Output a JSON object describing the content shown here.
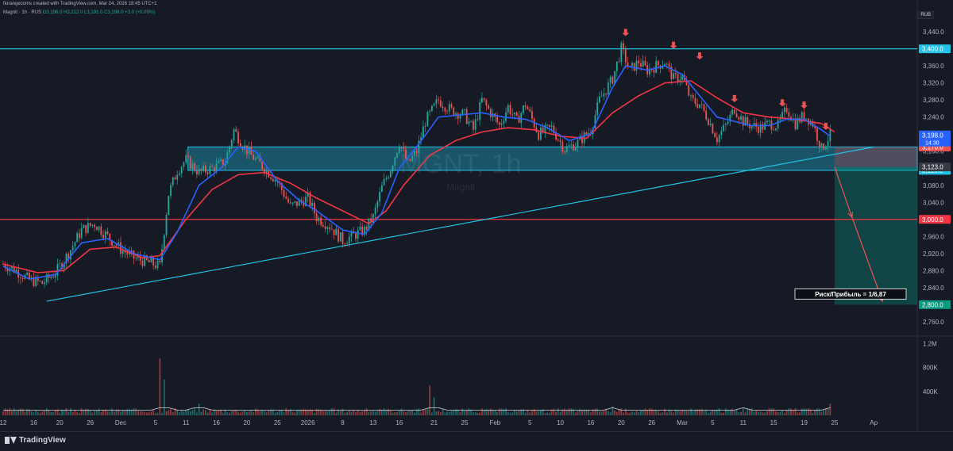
{
  "header": {
    "credit": "fiorangecoms created with TradingView.com, Mar 24, 2026 18:45 UTC+1"
  },
  "legend": {
    "symbol": "Magnit · 1h · RUS",
    "ohlc": "O3,196.0 H3,212.0 L3,191.0 C3,198.0 +3.0 (+0.09%)"
  },
  "currency": "RUB",
  "watermark": {
    "ticker": "MGNT, 1h",
    "name": "Magnit"
  },
  "brand": "TradingView",
  "colors": {
    "background": "#161a25",
    "up": "#26a69a",
    "down": "#ef5350",
    "ema_fast": "#2962ff",
    "ema_slow": "#f23645",
    "cyan": "#22c3e6",
    "red_line": "#f23645"
  },
  "chart_data": {
    "type": "candlestick",
    "timeframe": "1h",
    "ylim": [
      2730,
      3470
    ],
    "y_ticks": [
      3440,
      3400,
      3360,
      3320,
      3280,
      3240,
      3200,
      3160,
      3120,
      3080,
      3040,
      3000,
      2960,
      2920,
      2880,
      2840,
      2800,
      2760
    ],
    "y_tick_labels": [
      "3,440.0",
      "3,400.0",
      "3,360.0",
      "3,320.0",
      "3,280.0",
      "3,240.0",
      "3,200.0",
      "3,160.0",
      "3,120.0",
      "3,080.0",
      "3,040.0",
      "3,000.0",
      "2,960.0",
      "2,920.0",
      "2,880.0",
      "2,840.0",
      "2,800.0",
      "2,760.0"
    ],
    "x_tick_labels": [
      "12",
      "16",
      "20",
      "26",
      "Dec",
      "5",
      "11",
      "16",
      "20",
      "25",
      "2026",
      "8",
      "13",
      "16",
      "21",
      "25",
      "Feb",
      "5",
      "10",
      "16",
      "20",
      "26",
      "Mar",
      "5",
      "11",
      "15",
      "19",
      "25",
      "Ap"
    ],
    "x_tick_index": [
      0,
      7,
      13,
      20,
      27,
      35,
      42,
      49,
      56,
      63,
      70,
      78,
      85,
      91,
      99,
      106,
      113,
      121,
      128,
      135,
      142,
      149,
      156,
      163,
      170,
      177,
      184,
      191,
      200
    ],
    "close_path": [
      [
        0,
        2895
      ],
      [
        3,
        2880
      ],
      [
        6,
        2858
      ],
      [
        9,
        2850
      ],
      [
        12,
        2875
      ],
      [
        15,
        2920
      ],
      [
        18,
        2975
      ],
      [
        21,
        2990
      ],
      [
        24,
        2960
      ],
      [
        27,
        2930
      ],
      [
        30,
        2910
      ],
      [
        33,
        2900
      ],
      [
        36,
        2890
      ],
      [
        38,
        3060
      ],
      [
        40,
        3115
      ],
      [
        42,
        3140
      ],
      [
        45,
        3110
      ],
      [
        48,
        3120
      ],
      [
        51,
        3135
      ],
      [
        53,
        3210
      ],
      [
        55,
        3175
      ],
      [
        57,
        3150
      ],
      [
        60,
        3120
      ],
      [
        63,
        3090
      ],
      [
        66,
        3030
      ],
      [
        68,
        3040
      ],
      [
        70,
        3050
      ],
      [
        72,
        3005
      ],
      [
        75,
        2985
      ],
      [
        78,
        2950
      ],
      [
        81,
        2965
      ],
      [
        83,
        2975
      ],
      [
        85,
        3005
      ],
      [
        87,
        3075
      ],
      [
        89,
        3120
      ],
      [
        91,
        3180
      ],
      [
        93,
        3130
      ],
      [
        95,
        3160
      ],
      [
        97,
        3230
      ],
      [
        100,
        3280
      ],
      [
        103,
        3255
      ],
      [
        106,
        3245
      ],
      [
        108,
        3210
      ],
      [
        110,
        3280
      ],
      [
        112,
        3250
      ],
      [
        114,
        3220
      ],
      [
        116,
        3265
      ],
      [
        118,
        3230
      ],
      [
        120,
        3270
      ],
      [
        123,
        3200
      ],
      [
        126,
        3215
      ],
      [
        129,
        3165
      ],
      [
        132,
        3180
      ],
      [
        135,
        3210
      ],
      [
        137,
        3280
      ],
      [
        140,
        3330
      ],
      [
        142,
        3400
      ],
      [
        144,
        3350
      ],
      [
        146,
        3370
      ],
      [
        148,
        3350
      ],
      [
        150,
        3360
      ],
      [
        152,
        3370
      ],
      [
        154,
        3330
      ],
      [
        156,
        3335
      ],
      [
        158,
        3280
      ],
      [
        160,
        3270
      ],
      [
        162,
        3235
      ],
      [
        164,
        3190
      ],
      [
        166,
        3220
      ],
      [
        168,
        3260
      ],
      [
        170,
        3230
      ],
      [
        172,
        3220
      ],
      [
        174,
        3215
      ],
      [
        176,
        3225
      ],
      [
        178,
        3220
      ],
      [
        180,
        3260
      ],
      [
        182,
        3225
      ],
      [
        184,
        3245
      ],
      [
        186,
        3225
      ],
      [
        188,
        3165
      ],
      [
        190,
        3198
      ]
    ],
    "ema_fast_path": [
      [
        0,
        2890
      ],
      [
        6,
        2860
      ],
      [
        12,
        2870
      ],
      [
        18,
        2945
      ],
      [
        24,
        2955
      ],
      [
        30,
        2920
      ],
      [
        36,
        2905
      ],
      [
        40,
        2970
      ],
      [
        45,
        3080
      ],
      [
        50,
        3120
      ],
      [
        54,
        3170
      ],
      [
        58,
        3160
      ],
      [
        63,
        3090
      ],
      [
        68,
        3045
      ],
      [
        72,
        3020
      ],
      [
        78,
        2975
      ],
      [
        83,
        2965
      ],
      [
        87,
        3015
      ],
      [
        91,
        3120
      ],
      [
        95,
        3170
      ],
      [
        100,
        3240
      ],
      [
        105,
        3245
      ],
      [
        110,
        3250
      ],
      [
        115,
        3240
      ],
      [
        120,
        3235
      ],
      [
        125,
        3215
      ],
      [
        130,
        3185
      ],
      [
        135,
        3200
      ],
      [
        140,
        3310
      ],
      [
        143,
        3360
      ],
      [
        148,
        3350
      ],
      [
        152,
        3360
      ],
      [
        156,
        3340
      ],
      [
        160,
        3290
      ],
      [
        164,
        3240
      ],
      [
        168,
        3230
      ],
      [
        172,
        3220
      ],
      [
        176,
        3220
      ],
      [
        180,
        3235
      ],
      [
        184,
        3235
      ],
      [
        188,
        3210
      ],
      [
        190,
        3195
      ]
    ],
    "ema_slow_path": [
      [
        0,
        2895
      ],
      [
        8,
        2875
      ],
      [
        14,
        2880
      ],
      [
        20,
        2930
      ],
      [
        26,
        2935
      ],
      [
        32,
        2910
      ],
      [
        36,
        2915
      ],
      [
        42,
        3000
      ],
      [
        48,
        3070
      ],
      [
        54,
        3105
      ],
      [
        60,
        3110
      ],
      [
        66,
        3085
      ],
      [
        72,
        3050
      ],
      [
        78,
        3020
      ],
      [
        84,
        2990
      ],
      [
        88,
        3020
      ],
      [
        92,
        3080
      ],
      [
        98,
        3150
      ],
      [
        104,
        3185
      ],
      [
        110,
        3205
      ],
      [
        116,
        3215
      ],
      [
        122,
        3210
      ],
      [
        128,
        3195
      ],
      [
        134,
        3190
      ],
      [
        140,
        3250
      ],
      [
        146,
        3290
      ],
      [
        152,
        3320
      ],
      [
        158,
        3325
      ],
      [
        164,
        3285
      ],
      [
        170,
        3250
      ],
      [
        176,
        3240
      ],
      [
        182,
        3235
      ],
      [
        188,
        3225
      ],
      [
        191,
        3205
      ]
    ],
    "volume_ticks": [
      "1.2M",
      "800K",
      "400K"
    ],
    "volume_tick_values": [
      1200000,
      800000,
      400000
    ],
    "volume_ylim": [
      0,
      1300000
    ],
    "volume_spikes": [
      [
        36,
        950000
      ],
      [
        37,
        600000
      ],
      [
        45,
        200000
      ],
      [
        98,
        500000
      ],
      [
        99,
        300000
      ],
      [
        140,
        150000
      ],
      [
        170,
        120000
      ],
      [
        190,
        200000
      ]
    ],
    "volume_base": 80000,
    "levels": [
      {
        "price": 3400,
        "color": "#22c3e6",
        "label": "3,400.0"
      },
      {
        "price": 3000,
        "color": "#f23645",
        "label": "3,000.0"
      }
    ],
    "zone": {
      "top": 3170,
      "bottom": 3115,
      "from_index": 43,
      "label_top": "3,170.0",
      "label_bottom": "3,115.0"
    },
    "trendline": {
      "from": [
        10,
        2808
      ],
      "to": [
        200,
        3170
      ]
    },
    "price_labels": [
      {
        "price": 3198,
        "text": "3,198.0",
        "sub": "14:30",
        "color": "#2962ff"
      },
      {
        "price": 3123,
        "text": "3,123.0",
        "color": "#363a45"
      },
      {
        "price": 2800,
        "text": "2,800.0",
        "color": "#089981"
      }
    ],
    "short_position": {
      "entry": 3123,
      "stop": 3170,
      "target": 2800,
      "from_index": 191,
      "label": "Риск/Прибыль = 1/6,87"
    },
    "projection": [
      [
        191,
        3123
      ],
      [
        195,
        3005
      ],
      [
        202,
        2808
      ]
    ],
    "down_arrows_index": [
      143,
      154,
      160,
      168,
      179,
      184,
      189
    ],
    "down_arrows_price": [
      3430,
      3400,
      3375,
      3275,
      3265,
      3260,
      3210
    ]
  }
}
